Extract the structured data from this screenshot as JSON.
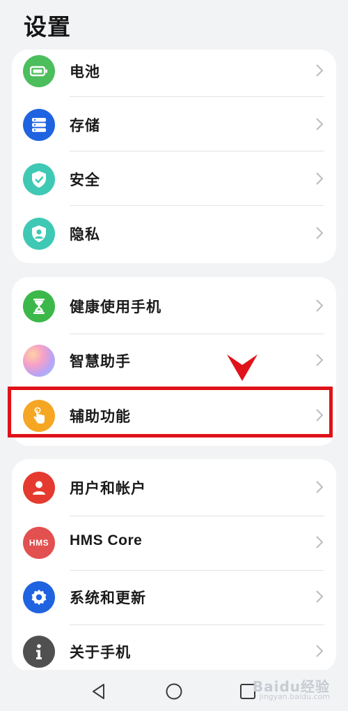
{
  "header": {
    "title": "设置"
  },
  "groups": [
    {
      "items": [
        {
          "label": "电池",
          "icon": "battery-icon",
          "color": "#4cbe5c"
        },
        {
          "label": "存储",
          "icon": "storage-icon",
          "color": "#1f63e0"
        },
        {
          "label": "安全",
          "icon": "shield-icon",
          "color": "#3fc9b4"
        },
        {
          "label": "隐私",
          "icon": "privacy-icon",
          "color": "#3fc9b4"
        }
      ]
    },
    {
      "items": [
        {
          "label": "健康使用手机",
          "icon": "hourglass-icon",
          "color": "#3cb84a"
        },
        {
          "label": "智慧助手",
          "icon": "assistant-icon",
          "color": "#c99cf2"
        },
        {
          "label": "辅助功能",
          "icon": "accessibility-icon",
          "color": "#f5a623"
        }
      ]
    },
    {
      "items": [
        {
          "label": "用户和帐户",
          "icon": "user-icon",
          "color": "#e53a2f"
        },
        {
          "label": "HMS Core",
          "icon": "hms-icon",
          "color": "#e25050",
          "icon_text": "HMS"
        },
        {
          "label": "系统和更新",
          "icon": "gear-icon",
          "color": "#1f63e0"
        },
        {
          "label": "关于手机",
          "icon": "info-icon",
          "color": "#505050"
        }
      ]
    }
  ],
  "annotation": {
    "highlight_color": "#e0121a"
  },
  "watermark": {
    "text": "Baidu经验",
    "sub": "jingyan.baidu.com"
  }
}
